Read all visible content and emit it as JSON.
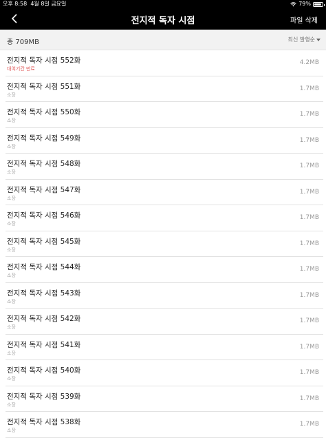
{
  "status_bar": {
    "time": "오후 8:58",
    "date": "4월 8일 금요일",
    "battery": "79%",
    "battery_level": 0.79
  },
  "header": {
    "title": "전지적 독자 시점",
    "delete_label": "파일 삭제"
  },
  "summary": {
    "total": "총 709MB",
    "sort_label": "최신 발행순"
  },
  "items": [
    {
      "title": "전지적 독자 시점 552화",
      "status": "대여기간 만료",
      "size": "4.2MB"
    },
    {
      "title": "전지적 독자 시점 551화",
      "status": "소장",
      "size": "1.7MB"
    },
    {
      "title": "전지적 독자 시점 550화",
      "status": "소장",
      "size": "1.7MB"
    },
    {
      "title": "전지적 독자 시점 549화",
      "status": "소장",
      "size": "1.7MB"
    },
    {
      "title": "전지적 독자 시점 548화",
      "status": "소장",
      "size": "1.7MB"
    },
    {
      "title": "전지적 독자 시점 547화",
      "status": "소장",
      "size": "1.7MB"
    },
    {
      "title": "전지적 독자 시점 546화",
      "status": "소장",
      "size": "1.7MB"
    },
    {
      "title": "전지적 독자 시점 545화",
      "status": "소장",
      "size": "1.7MB"
    },
    {
      "title": "전지적 독자 시점 544화",
      "status": "소장",
      "size": "1.7MB"
    },
    {
      "title": "전지적 독자 시점 543화",
      "status": "소장",
      "size": "1.7MB"
    },
    {
      "title": "전지적 독자 시점 542화",
      "status": "소장",
      "size": "1.7MB"
    },
    {
      "title": "전지적 독자 시점 541화",
      "status": "소장",
      "size": "1.7MB"
    },
    {
      "title": "전지적 독자 시점 540화",
      "status": "소장",
      "size": "1.7MB"
    },
    {
      "title": "전지적 독자 시점 539화",
      "status": "소장",
      "size": "1.7MB"
    },
    {
      "title": "전지적 독자 시점 538화",
      "status": "소장",
      "size": "1.7MB"
    }
  ]
}
